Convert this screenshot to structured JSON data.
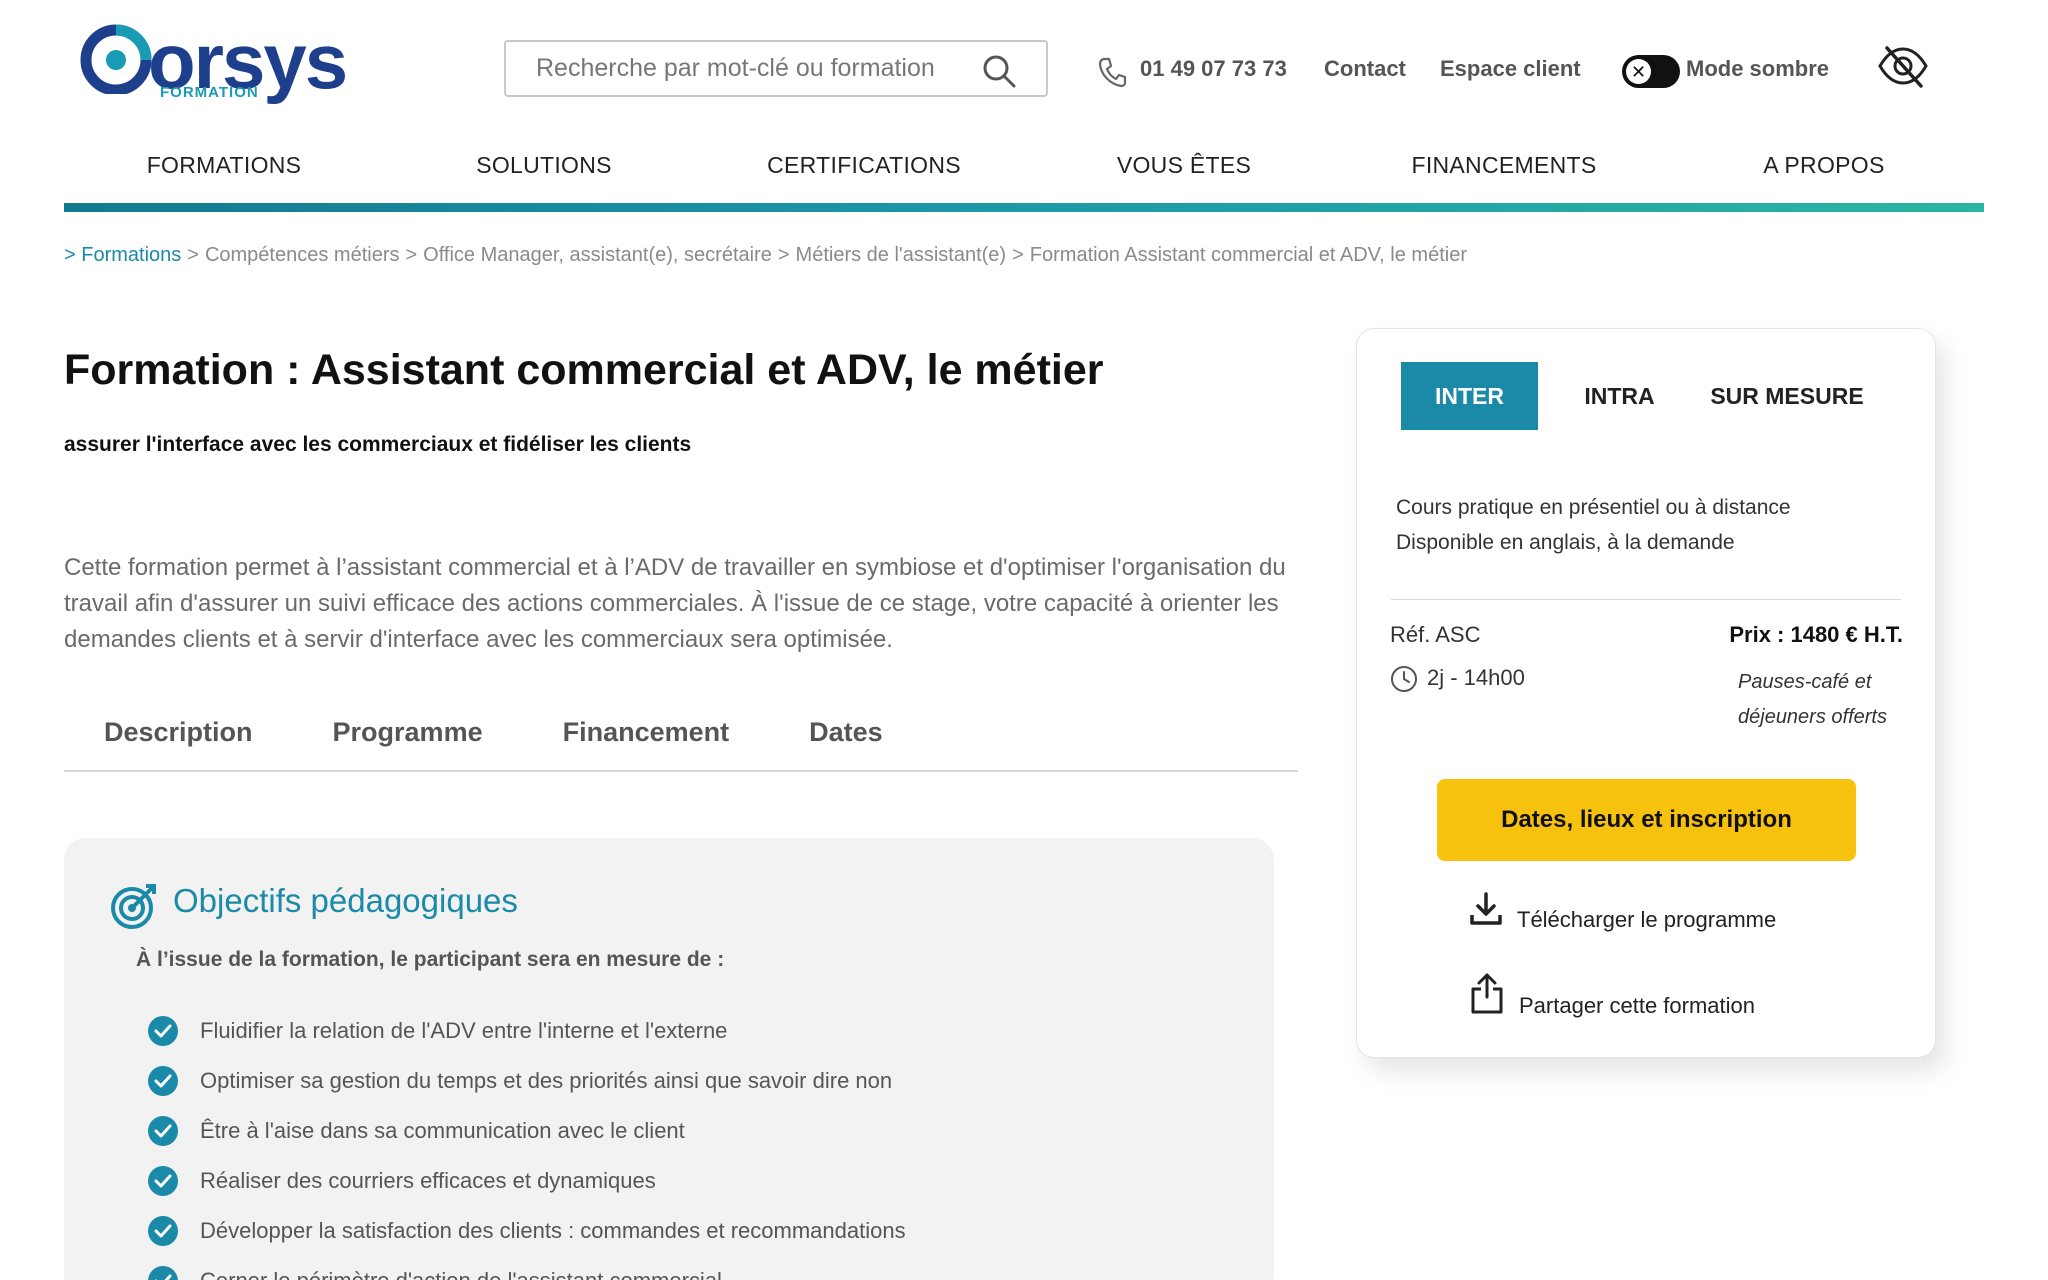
{
  "header": {
    "logo_text": "orsys",
    "logo_sub": "FORMATION",
    "search_placeholder": "Recherche par mot-clé ou formation",
    "phone": "01 49 07 73 73",
    "contact": "Contact",
    "espace_client": "Espace client",
    "dark_mode_label": "Mode sombre",
    "toggle_glyph": "✕"
  },
  "nav": {
    "items": [
      "FORMATIONS",
      "SOLUTIONS",
      "CERTIFICATIONS",
      "VOUS ÊTES",
      "FINANCEMENTS",
      "A PROPOS"
    ]
  },
  "breadcrumb": [
    "> Formations",
    "Compétences métiers",
    "Office Manager, assistant(e), secrétaire",
    "Métiers de l'assistant(e)",
    "Formation Assistant commercial et ADV, le métier"
  ],
  "main": {
    "title": "Formation : Assistant commercial et ADV, le métier",
    "subtitle": "assurer l'interface avec les commerciaux et fidéliser les clients",
    "intro": "Cette formation permet à l’assistant commercial et à l’ADV de travailler en symbiose et d'optimiser l'organisation du travail afin d'assurer un suivi efficace des actions commerciales. À l'issue de ce stage, votre capacité à orienter les demandes clients et à servir d'interface avec les commerciaux sera optimisée.",
    "tabs": [
      "Description",
      "Programme",
      "Financement",
      "Dates"
    ]
  },
  "objectives": {
    "title": "Objectifs pédagogiques",
    "lead": "À l’issue de la formation, le participant sera en mesure de :",
    "items": [
      "Fluidifier la relation de l'ADV entre l'interne et l'externe",
      "Optimiser sa gestion du temps et des priorités ainsi que savoir dire non",
      "Être à l'aise dans sa communication avec le client",
      "Réaliser des courriers efficaces et dynamiques",
      "Développer la satisfaction des clients : commandes et recommandations",
      "Cerner le périmètre d'action de l'assistant commercial"
    ]
  },
  "card": {
    "tabs": [
      "INTER",
      "INTRA",
      "SUR MESURE"
    ],
    "active_tab": "INTER",
    "line1": "Cours pratique en présentiel ou à distance",
    "line2": "Disponible en anglais, à la demande",
    "ref": "Réf. ASC",
    "duration": "2j - 14h00",
    "price": "Prix : 1480 € H.T.",
    "pauses": "Pauses-café et déjeuners offerts",
    "cta": "Dates, lieux et inscription",
    "download": "Télécharger le programme",
    "share": "Partager cette formation"
  },
  "colors": {
    "accent": "#1a8aa8",
    "brand_blue": "#1d3f8c",
    "cta_yellow": "#f7c20e"
  },
  "icons": [
    "search-icon",
    "phone-icon",
    "eye-slash-icon",
    "target-icon",
    "check-icon",
    "clock-icon",
    "download-icon",
    "share-icon"
  ]
}
